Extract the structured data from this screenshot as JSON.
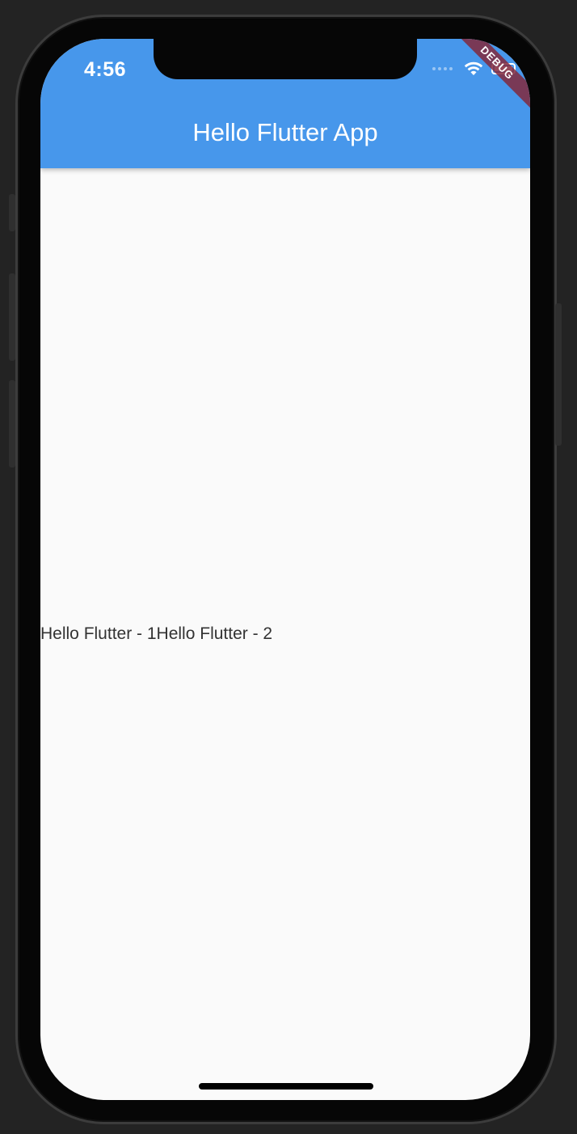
{
  "status_bar": {
    "time": "4:56",
    "wifi_icon": "wifi-icon",
    "battery_icon": "battery-icon"
  },
  "debug_banner": {
    "label": "DEBUG"
  },
  "app_bar": {
    "title": "Hello Flutter App",
    "color": "#4797eb"
  },
  "body": {
    "texts": [
      "Hello Flutter - 1",
      "Hello Flutter - 2"
    ],
    "background": "#fafafa"
  }
}
